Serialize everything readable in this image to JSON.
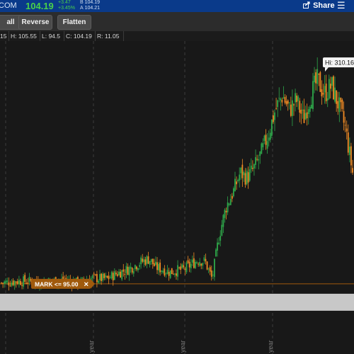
{
  "header": {
    "symbol_text": "COM",
    "last_price": "104.19",
    "net_change": "+3.47",
    "pct_change": "+3.45%",
    "bid_label": "B",
    "bid_value": "104.19",
    "ask_label": "A",
    "ask_value": "104.21",
    "share_label": "Share",
    "menu_icon": "menu-icon"
  },
  "toolbar": {
    "buttons": [
      "all",
      "Reverse",
      "Flatten"
    ]
  },
  "ohlc": {
    "o": "15",
    "h": "H: 105.55",
    "l": "L: 94.5",
    "c": "C: 104.19",
    "r": "R: 11.05"
  },
  "chart": {
    "hi_label": "Hi: 310.16",
    "order_label": "MARK <= 95.00",
    "order_close_icon": "close-icon",
    "year_labels": [
      "year",
      "year",
      "year"
    ],
    "colors": {
      "up": "#2ea84a",
      "down": "#f08a24",
      "order": "#a05a0c",
      "hi_box": "#f4f4f4",
      "gray_band": "#c8c8c8"
    }
  },
  "chart_data": {
    "type": "candlestick",
    "title": "",
    "series_note": "",
    "ylim": [
      40,
      330
    ],
    "hi": 310.16,
    "order_level": 95.0,
    "close_path": [
      [
        0,
        96
      ],
      [
        0.05,
        98
      ],
      [
        0.12,
        97
      ],
      [
        0.18,
        99
      ],
      [
        0.22,
        96
      ],
      [
        0.26,
        101
      ],
      [
        0.3,
        100
      ],
      [
        0.33,
        106
      ],
      [
        0.36,
        110
      ],
      [
        0.38,
        114
      ],
      [
        0.4,
        118
      ],
      [
        0.42,
        121
      ],
      [
        0.44,
        112
      ],
      [
        0.46,
        110
      ],
      [
        0.48,
        107
      ],
      [
        0.5,
        109
      ],
      [
        0.52,
        110
      ],
      [
        0.54,
        115
      ],
      [
        0.56,
        120
      ],
      [
        0.58,
        118
      ],
      [
        0.6,
        100
      ],
      [
        0.62,
        145
      ],
      [
        0.64,
        175
      ],
      [
        0.66,
        190
      ],
      [
        0.68,
        210
      ],
      [
        0.7,
        205
      ],
      [
        0.72,
        215
      ],
      [
        0.74,
        230
      ],
      [
        0.76,
        250
      ],
      [
        0.78,
        275
      ],
      [
        0.8,
        290
      ],
      [
        0.82,
        275
      ],
      [
        0.84,
        285
      ],
      [
        0.86,
        265
      ],
      [
        0.88,
        290
      ],
      [
        0.9,
        305
      ],
      [
        0.92,
        292
      ],
      [
        0.94,
        300
      ],
      [
        0.96,
        280
      ],
      [
        0.98,
        255
      ],
      [
        1.0,
        210
      ]
    ]
  }
}
